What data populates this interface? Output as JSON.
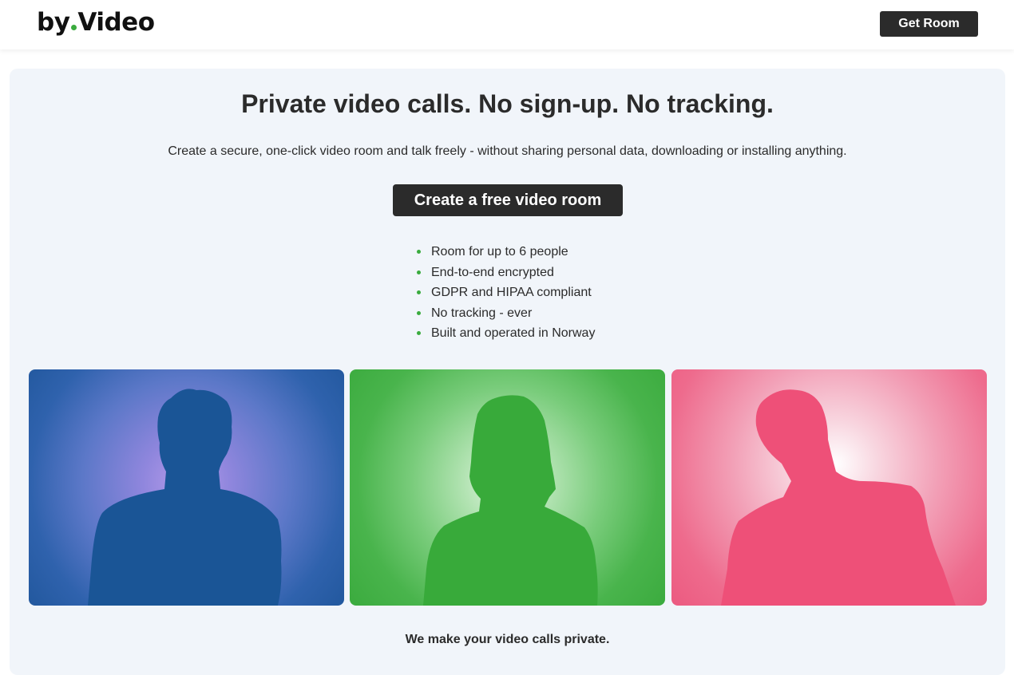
{
  "brand": {
    "logo_prefix": "by",
    "logo_suffix": "Video",
    "dot_color": "#3aab3e"
  },
  "header": {
    "get_room_label": "Get Room"
  },
  "hero": {
    "headline": "Private video calls. No sign-up. No tracking.",
    "subtitle": "Create a secure, one-click video room and talk freely - without sharing personal data, downloading or installing anything.",
    "cta_label": "Create a free video room"
  },
  "features": [
    "Room for up to 6 people",
    "End-to-end encrypted",
    "GDPR and HIPAA compliant",
    "No tracking - ever",
    "Built and operated in Norway"
  ],
  "tiles": [
    {
      "name": "blue-participant",
      "silhouette_color": "#1a5596"
    },
    {
      "name": "green-participant",
      "silhouette_color": "#38aa3a"
    },
    {
      "name": "pink-participant",
      "silhouette_color": "#ee5078"
    }
  ],
  "tagline": "We make your video calls private."
}
